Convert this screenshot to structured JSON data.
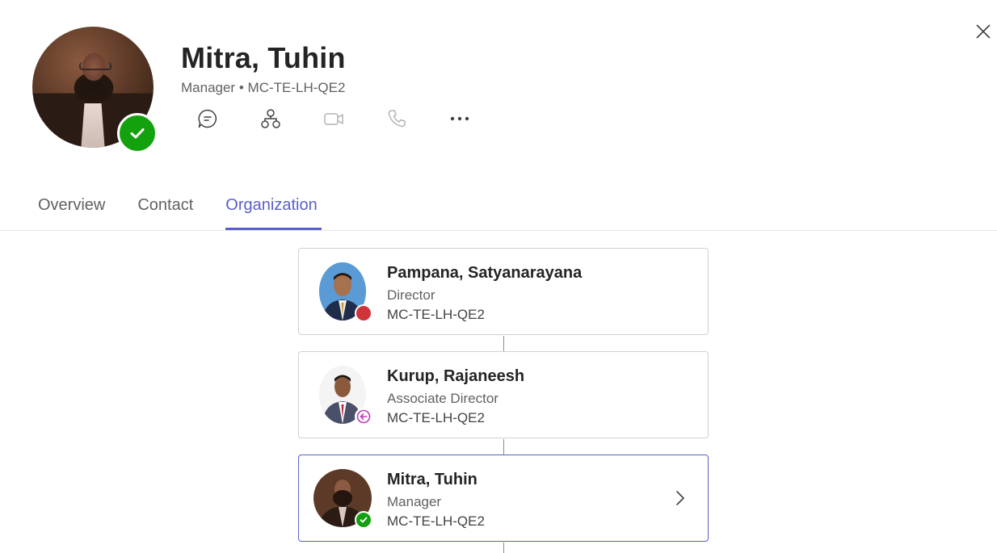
{
  "profile": {
    "name": "Mitra, Tuhin",
    "role": "Manager",
    "separator": "•",
    "department": "MC-TE-LH-QE2",
    "presence": "available",
    "actions": [
      {
        "icon": "chat-icon"
      },
      {
        "icon": "org-chart-icon"
      },
      {
        "icon": "video-call-icon"
      },
      {
        "icon": "phone-call-icon"
      },
      {
        "icon": "more-options-icon"
      }
    ]
  },
  "tabs": [
    {
      "label": "Overview",
      "active": false
    },
    {
      "label": "Contact",
      "active": false
    },
    {
      "label": "Organization",
      "active": true
    }
  ],
  "org_chart": [
    {
      "name": "Pampana, Satyanarayana",
      "title": "Director",
      "department": "MC-TE-LH-QE2",
      "presence": "busy"
    },
    {
      "name": "Kurup, Rajaneesh",
      "title": "Associate Director",
      "department": "MC-TE-LH-QE2",
      "presence": "out-of-office"
    },
    {
      "name": "Mitra, Tuhin",
      "title": "Manager",
      "department": "MC-TE-LH-QE2",
      "presence": "available",
      "selected": true
    }
  ],
  "colors": {
    "accent": "#5b5fc7",
    "available": "#13a10e",
    "busy": "#d13438",
    "out_of_office": "#c239b3"
  }
}
